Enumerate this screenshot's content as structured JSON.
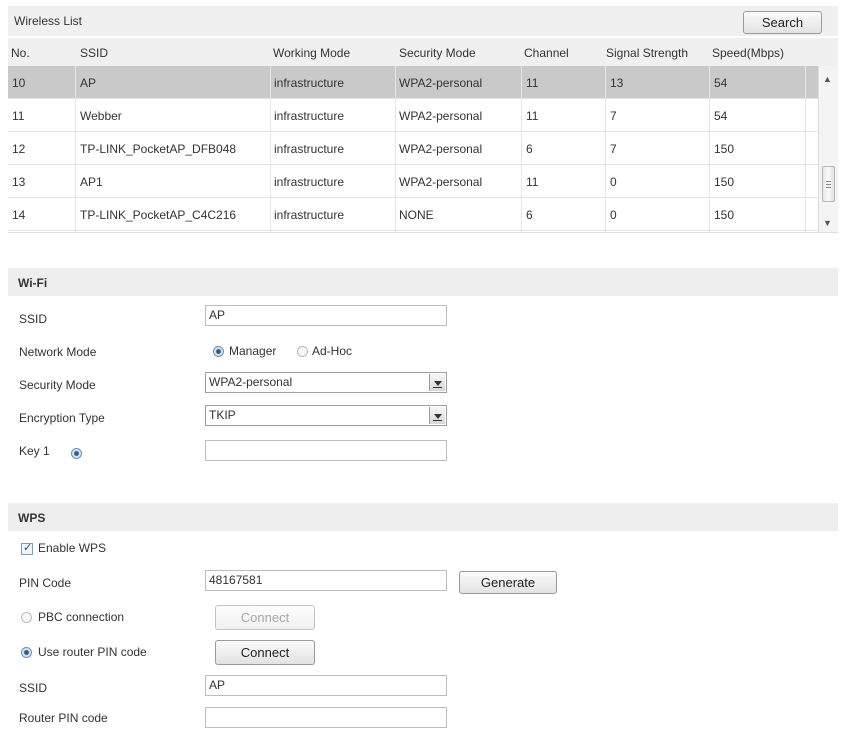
{
  "wireless_list": {
    "title": "Wireless List",
    "search_label": "Search",
    "columns": [
      "No.",
      "SSID",
      "Working Mode",
      "Security Mode",
      "Channel",
      "Signal Strength",
      "Speed(Mbps)"
    ],
    "rows": [
      {
        "no": "10",
        "ssid": "AP",
        "mode": "infrastructure",
        "security": "WPA2-personal",
        "channel": "11",
        "signal": "13",
        "speed": "54",
        "selected": true
      },
      {
        "no": "11",
        "ssid": "Webber",
        "mode": "infrastructure",
        "security": "WPA2-personal",
        "channel": "11",
        "signal": "7",
        "speed": "54",
        "selected": false
      },
      {
        "no": "12",
        "ssid": "TP-LINK_PocketAP_DFB048",
        "mode": "infrastructure",
        "security": "WPA2-personal",
        "channel": "6",
        "signal": "7",
        "speed": "150",
        "selected": false
      },
      {
        "no": "13",
        "ssid": "AP1",
        "mode": "infrastructure",
        "security": "WPA2-personal",
        "channel": "11",
        "signal": "0",
        "speed": "150",
        "selected": false
      },
      {
        "no": "14",
        "ssid": "TP-LINK_PocketAP_C4C216",
        "mode": "infrastructure",
        "security": "NONE",
        "channel": "6",
        "signal": "0",
        "speed": "150",
        "selected": false
      }
    ]
  },
  "wifi": {
    "title": "Wi-Fi",
    "ssid_label": "SSID",
    "ssid_value": "AP",
    "network_mode_label": "Network Mode",
    "mode_manager": "Manager",
    "mode_adhoc": "Ad-Hoc",
    "security_mode_label": "Security Mode",
    "security_mode_value": "WPA2-personal",
    "encryption_label": "Encryption Type",
    "encryption_value": "TKIP",
    "key1_label": "Key 1",
    "key1_value": ""
  },
  "wps": {
    "title": "WPS",
    "enable_label": "Enable WPS",
    "enable_checked": true,
    "pin_code_label": "PIN Code",
    "pin_code_value": "48167581",
    "generate_label": "Generate",
    "pbc_label": "PBC connection",
    "pbc_connect_label": "Connect",
    "router_pin_label": "Use router PIN code",
    "router_connect_label": "Connect",
    "ssid_label": "SSID",
    "ssid_value": "AP",
    "router_pin_code_label": "Router PIN code",
    "router_pin_code_value": ""
  },
  "colors": {
    "selected_row": "#c9c9c9",
    "section_bg": "#eeeeee",
    "radio_on": "#2a5b8d"
  }
}
